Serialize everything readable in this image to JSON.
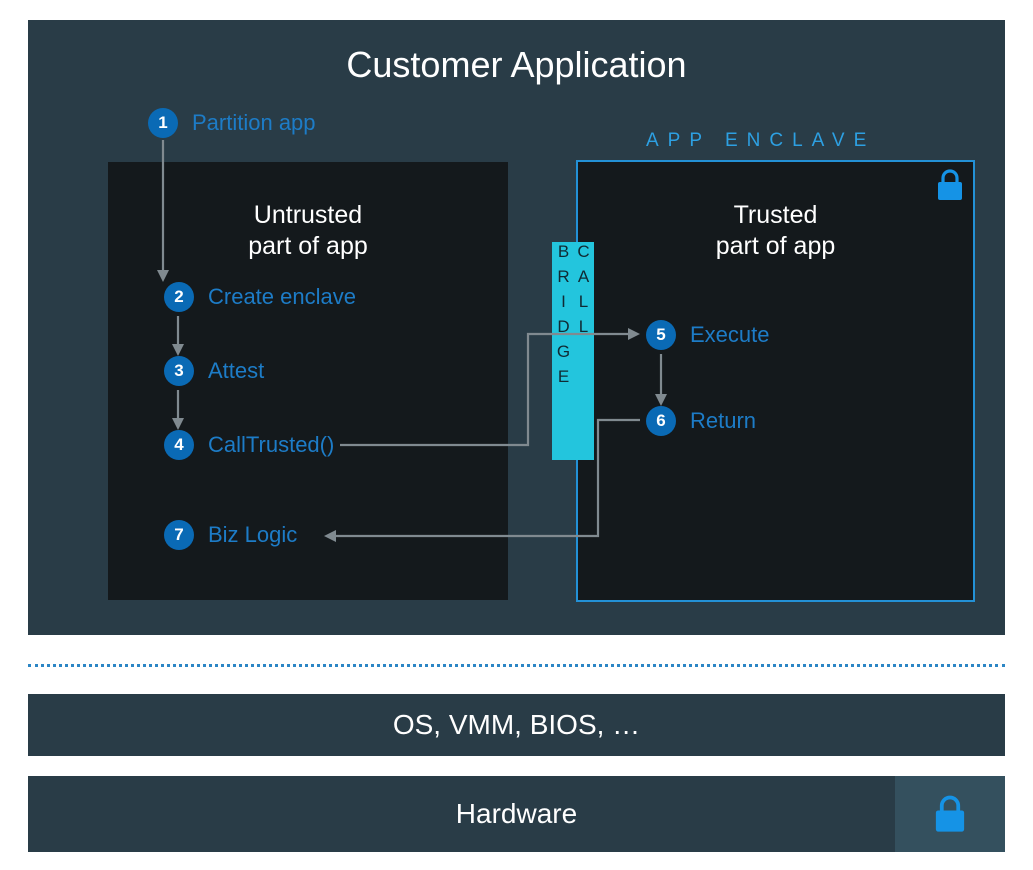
{
  "title": "Customer Application",
  "enclave_label": "APP ENCLAVE",
  "call_bridge": "CALL BRIDGE",
  "untrusted": {
    "heading_l1": "Untrusted",
    "heading_l2": "part of app"
  },
  "trusted": {
    "heading_l1": "Trusted",
    "heading_l2": "part of app"
  },
  "steps": {
    "s1": {
      "n": "1",
      "label": "Partition app"
    },
    "s2": {
      "n": "2",
      "label": "Create enclave"
    },
    "s3": {
      "n": "3",
      "label": "Attest"
    },
    "s4": {
      "n": "4",
      "label": "CallTrusted()"
    },
    "s5": {
      "n": "5",
      "label": "Execute"
    },
    "s6": {
      "n": "6",
      "label": "Return"
    },
    "s7": {
      "n": "7",
      "label": "Biz Logic"
    }
  },
  "layers": {
    "os": "OS, VMM, BIOS, …",
    "hardware": "Hardware"
  },
  "colors": {
    "panel_bg": "#293c47",
    "box_bg": "#14191c",
    "accent_blue": "#0a6ab5",
    "text_blue": "#1d7cc7",
    "outline_blue": "#2391d6",
    "bridge_cyan": "#23c5dd",
    "arrow": "#808a90"
  }
}
